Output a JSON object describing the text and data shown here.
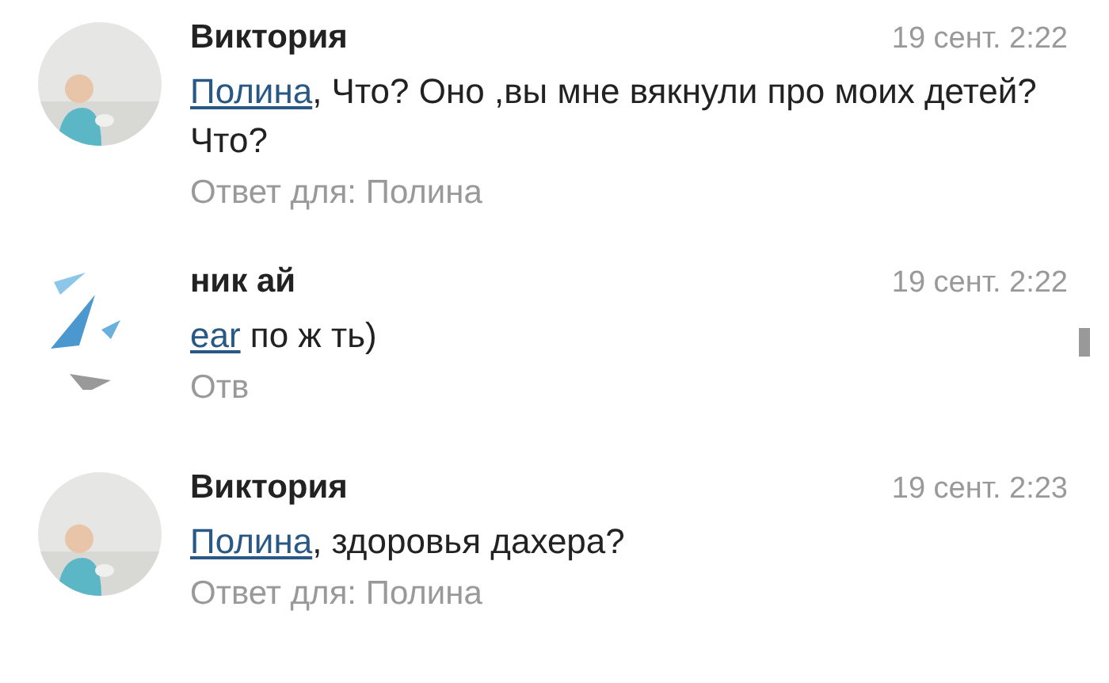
{
  "comments": [
    {
      "kind": "normal",
      "author": "Виктория",
      "date": "19 сент. 2:22",
      "mention": "Полина",
      "text": ", Что? Оно ,вы мне вякнули про моих детей? Что?",
      "reply": "Ответ для: Полина"
    },
    {
      "kind": "obscured",
      "author": "ник ай",
      "date": "19 сент. 2:22",
      "mention": "ear",
      "text": "по ж ть)",
      "reply": "Отв"
    },
    {
      "kind": "normal",
      "author": "Виктория",
      "date": "19 сент. 2:23",
      "mention": "Полина",
      "text": ", здоровья дахера?",
      "reply": "Ответ для: Полина"
    }
  ]
}
